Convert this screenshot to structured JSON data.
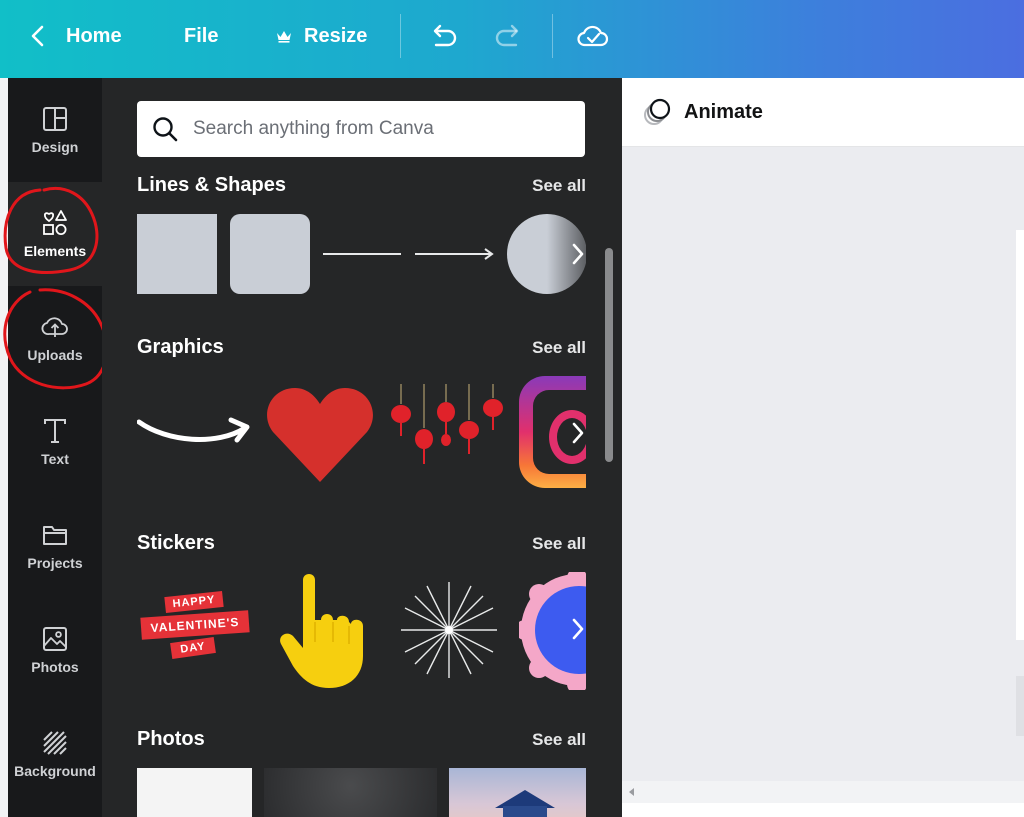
{
  "topbar": {
    "home_label": "Home",
    "file_label": "File",
    "resize_label": "Resize",
    "resize_icon": "crown-icon",
    "undo_icon": "undo-icon",
    "redo_icon": "redo-icon",
    "save_status_icon": "cloud-check-icon"
  },
  "nav": {
    "items": [
      {
        "label": "Design",
        "icon": "layout-icon"
      },
      {
        "label": "Elements",
        "icon": "shapes-icon"
      },
      {
        "label": "Uploads",
        "icon": "cloud-upload-icon"
      },
      {
        "label": "Text",
        "icon": "text-icon"
      },
      {
        "label": "Projects",
        "icon": "folder-icon"
      },
      {
        "label": "Photos",
        "icon": "image-icon"
      },
      {
        "label": "Background",
        "icon": "hatch-icon"
      }
    ],
    "active": "Elements"
  },
  "search": {
    "placeholder": "Search anything from Canva"
  },
  "sections": [
    {
      "title": "Lines & Shapes",
      "see_all": "See all"
    },
    {
      "title": "Graphics",
      "see_all": "See all"
    },
    {
      "title": "Stickers",
      "see_all": "See all"
    },
    {
      "title": "Photos",
      "see_all": "See all"
    }
  ],
  "stickers": {
    "valentine_lines": [
      "HAPPY",
      "VALENTINE'S",
      "DAY"
    ]
  },
  "right": {
    "animate_label": "Animate"
  },
  "colors": {
    "topbar_start": "#11bfc8",
    "topbar_end": "#4b6ee0",
    "panel_bg": "#252627",
    "rail_bg": "#18191b",
    "annotation_red": "#e0161b"
  }
}
